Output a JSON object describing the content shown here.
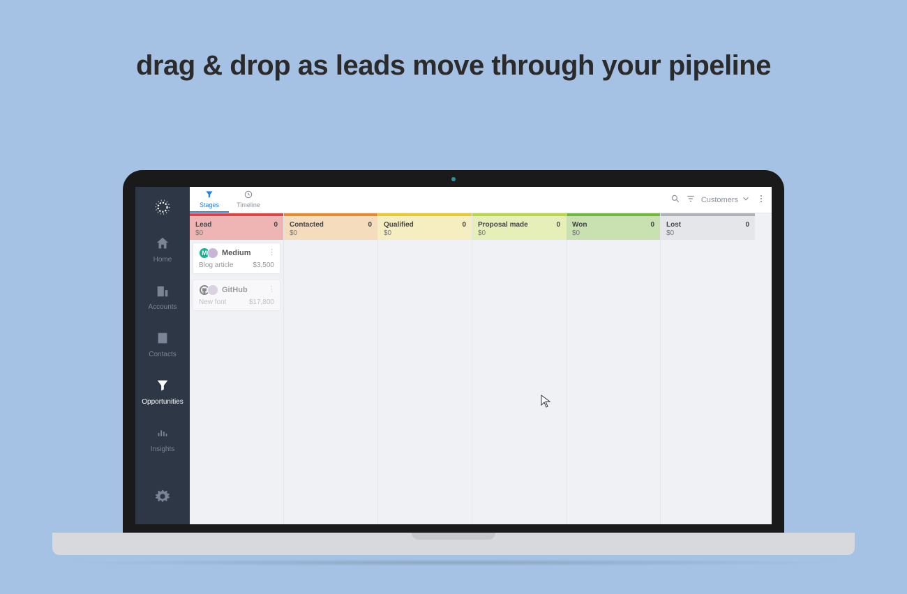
{
  "headline": "drag & drop as leads move through your pipeline",
  "sidebar": {
    "items": [
      {
        "label": "Home"
      },
      {
        "label": "Accounts"
      },
      {
        "label": "Contacts"
      },
      {
        "label": "Opportunities"
      },
      {
        "label": "Insights"
      }
    ],
    "active_index": 3
  },
  "topbar": {
    "tabs": [
      {
        "label": "Stages"
      },
      {
        "label": "Timeline"
      }
    ],
    "active_tab_index": 0,
    "view_label": "Customers"
  },
  "stages": [
    {
      "name": "Lead",
      "count": 0,
      "amount": "$0"
    },
    {
      "name": "Contacted",
      "count": 0,
      "amount": "$0"
    },
    {
      "name": "Qualified",
      "count": 0,
      "amount": "$0"
    },
    {
      "name": "Proposal made",
      "count": 0,
      "amount": "$0"
    },
    {
      "name": "Won",
      "count": 0,
      "amount": "$0"
    },
    {
      "name": "Lost",
      "count": 0,
      "amount": "$0"
    }
  ],
  "cards": [
    {
      "stage_index": 0,
      "company": "Medium",
      "subject": "Blog article",
      "amount": "$3,500"
    },
    {
      "stage_index": 0,
      "company": "GitHub",
      "subject": "New font",
      "amount": "$17,800",
      "dragging": true
    }
  ]
}
